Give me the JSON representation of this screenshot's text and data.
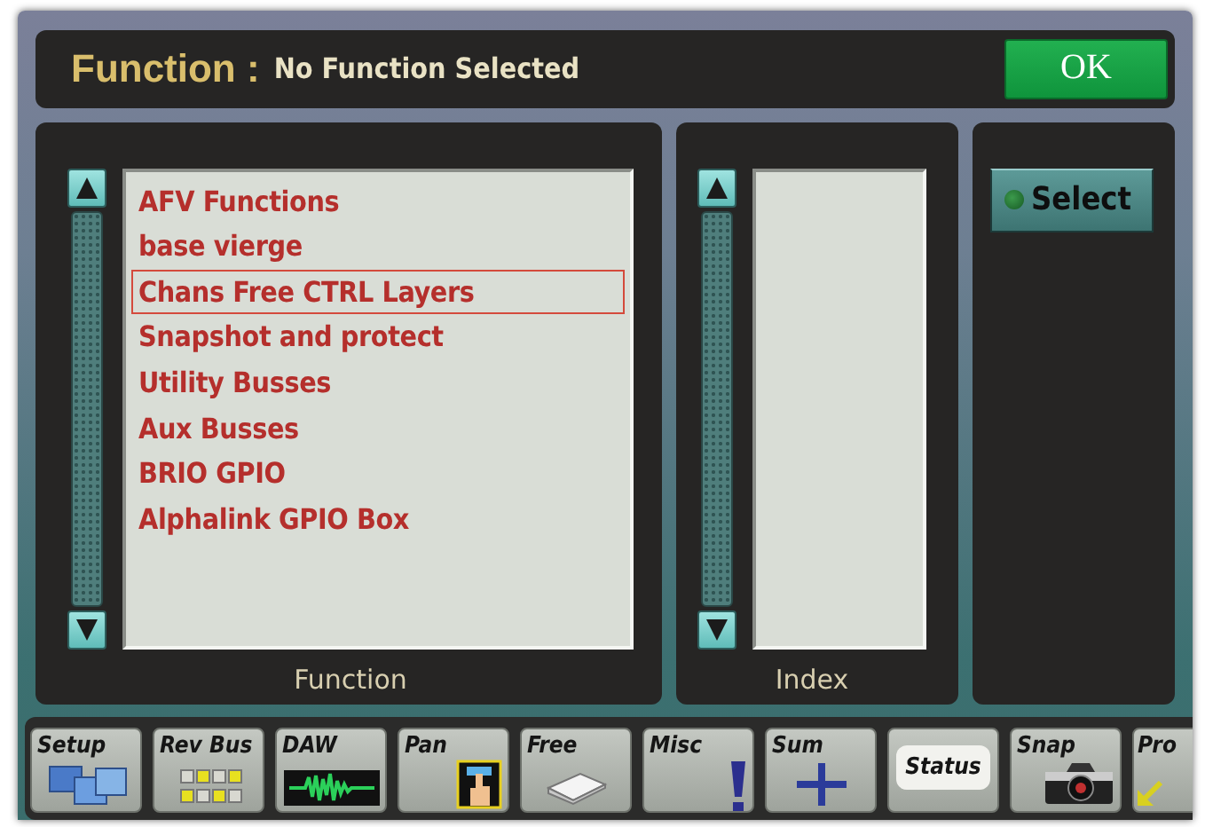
{
  "header": {
    "title": "Function :",
    "value": "No Function Selected",
    "ok_button": "OK"
  },
  "function_panel": {
    "label": "Function",
    "items": [
      {
        "label": "AFV Functions",
        "selected": false
      },
      {
        "label": "base vierge",
        "selected": false
      },
      {
        "label": "Chans Free CTRL Layers",
        "selected": true
      },
      {
        "label": "Snapshot and protect",
        "selected": false
      },
      {
        "label": "Utility Busses",
        "selected": false
      },
      {
        "label": "Aux Busses",
        "selected": false
      },
      {
        "label": "BRIO GPIO",
        "selected": false
      },
      {
        "label": "Alphalink GPIO Box",
        "selected": false
      }
    ]
  },
  "index_panel": {
    "label": "Index"
  },
  "select_button": "Select",
  "toolbar": [
    {
      "label": "Setup",
      "selected": false
    },
    {
      "label": "Rev Bus",
      "selected": false
    },
    {
      "label": "DAW",
      "selected": false
    },
    {
      "label": "Pan",
      "selected": false
    },
    {
      "label": "Free",
      "selected": false
    },
    {
      "label": "Misc",
      "selected": false
    },
    {
      "label": "Sum",
      "selected": false
    },
    {
      "label": "Status",
      "selected": true
    },
    {
      "label": "Snap",
      "selected": false
    },
    {
      "label": "Pro",
      "selected": false
    }
  ]
}
